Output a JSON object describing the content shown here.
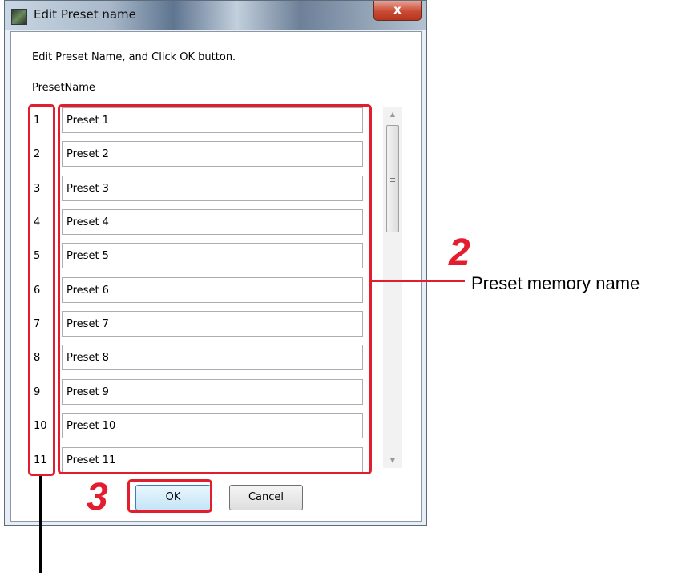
{
  "window": {
    "title": "Edit Preset name",
    "close_glyph": "x"
  },
  "dialog": {
    "instruction": "Edit Preset Name, and Click OK button.",
    "column_header": "PresetName",
    "rows": [
      {
        "number": "1",
        "value": "Preset 1"
      },
      {
        "number": "2",
        "value": "Preset 2"
      },
      {
        "number": "3",
        "value": "Preset 3"
      },
      {
        "number": "4",
        "value": "Preset 4"
      },
      {
        "number": "5",
        "value": "Preset 5"
      },
      {
        "number": "6",
        "value": "Preset 6"
      },
      {
        "number": "7",
        "value": "Preset 7"
      },
      {
        "number": "8",
        "value": "Preset 8"
      },
      {
        "number": "9",
        "value": "Preset 9"
      },
      {
        "number": "10",
        "value": "Preset 10"
      },
      {
        "number": "11",
        "value": "Preset 11"
      }
    ],
    "ok_label": "OK",
    "cancel_label": "Cancel"
  },
  "annotations": {
    "callout_2_number": "2",
    "callout_2_label": "Preset memory name",
    "callout_3_number": "3",
    "accent_color": "#e21e2e"
  }
}
